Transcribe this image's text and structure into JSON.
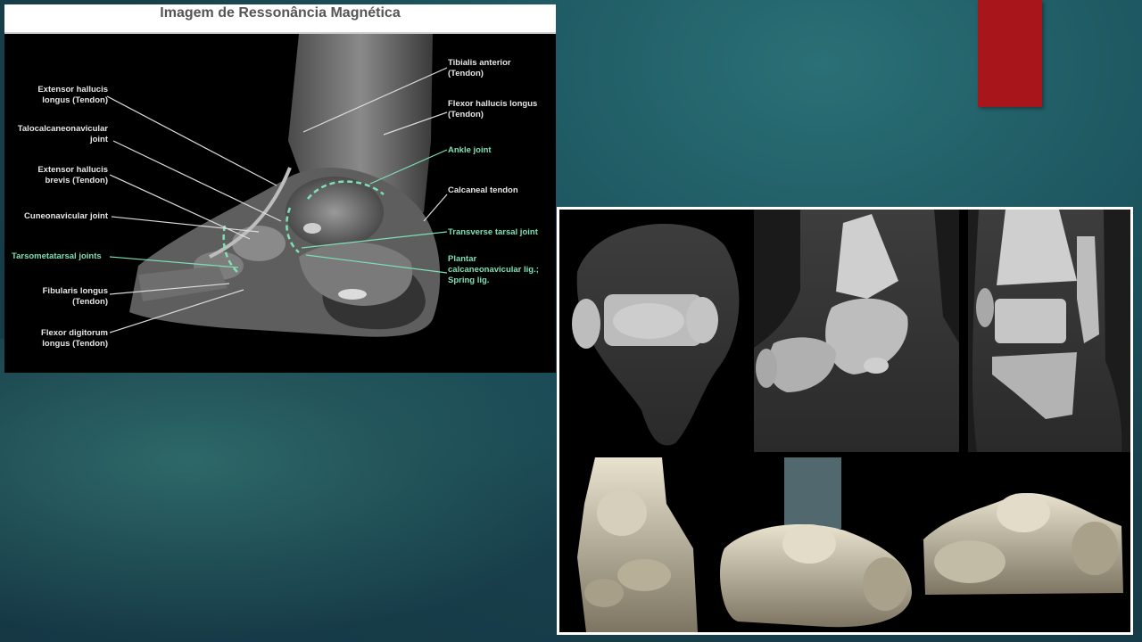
{
  "mri": {
    "title": "Imagem de Ressonância Magnética",
    "labels": {
      "ext_hall_longus_1": "Extensor hallucis",
      "ext_hall_longus_2": "longus (Tendon)",
      "talocalc_1": "Talocalcaneonavicular",
      "talocalc_2": "joint",
      "ext_hall_brevis_1": "Extensor hallucis",
      "ext_hall_brevis_2": "brevis (Tendon)",
      "cuneonavicular": "Cuneonavicular joint",
      "tarsometatarsal": "Tarsometatarsal joints",
      "fibularis_1": "Fibularis longus",
      "fibularis_2": "(Tendon)",
      "flexor_dig_1": "Flexor digitorum",
      "flexor_dig_2": "longus (Tendon)",
      "tibialis_1": "Tibialis anterior",
      "tibialis_2": "(Tendon)",
      "flexor_hall_1": "Flexor hallucis longus",
      "flexor_hall_2": "(Tendon)",
      "ankle_joint": "Ankle joint",
      "calcaneal": "Calcaneal tendon",
      "transverse": "Transverse tarsal joint",
      "plantar_1": "Plantar",
      "plantar_2": "calcaneonavicular lig.;",
      "plantar_3": "Spring lig."
    }
  },
  "colors": {
    "accent_red": "#a8161b",
    "label_white": "#e6e6e6",
    "label_green": "#7ee0b5",
    "background_teal": "#1d5660"
  }
}
